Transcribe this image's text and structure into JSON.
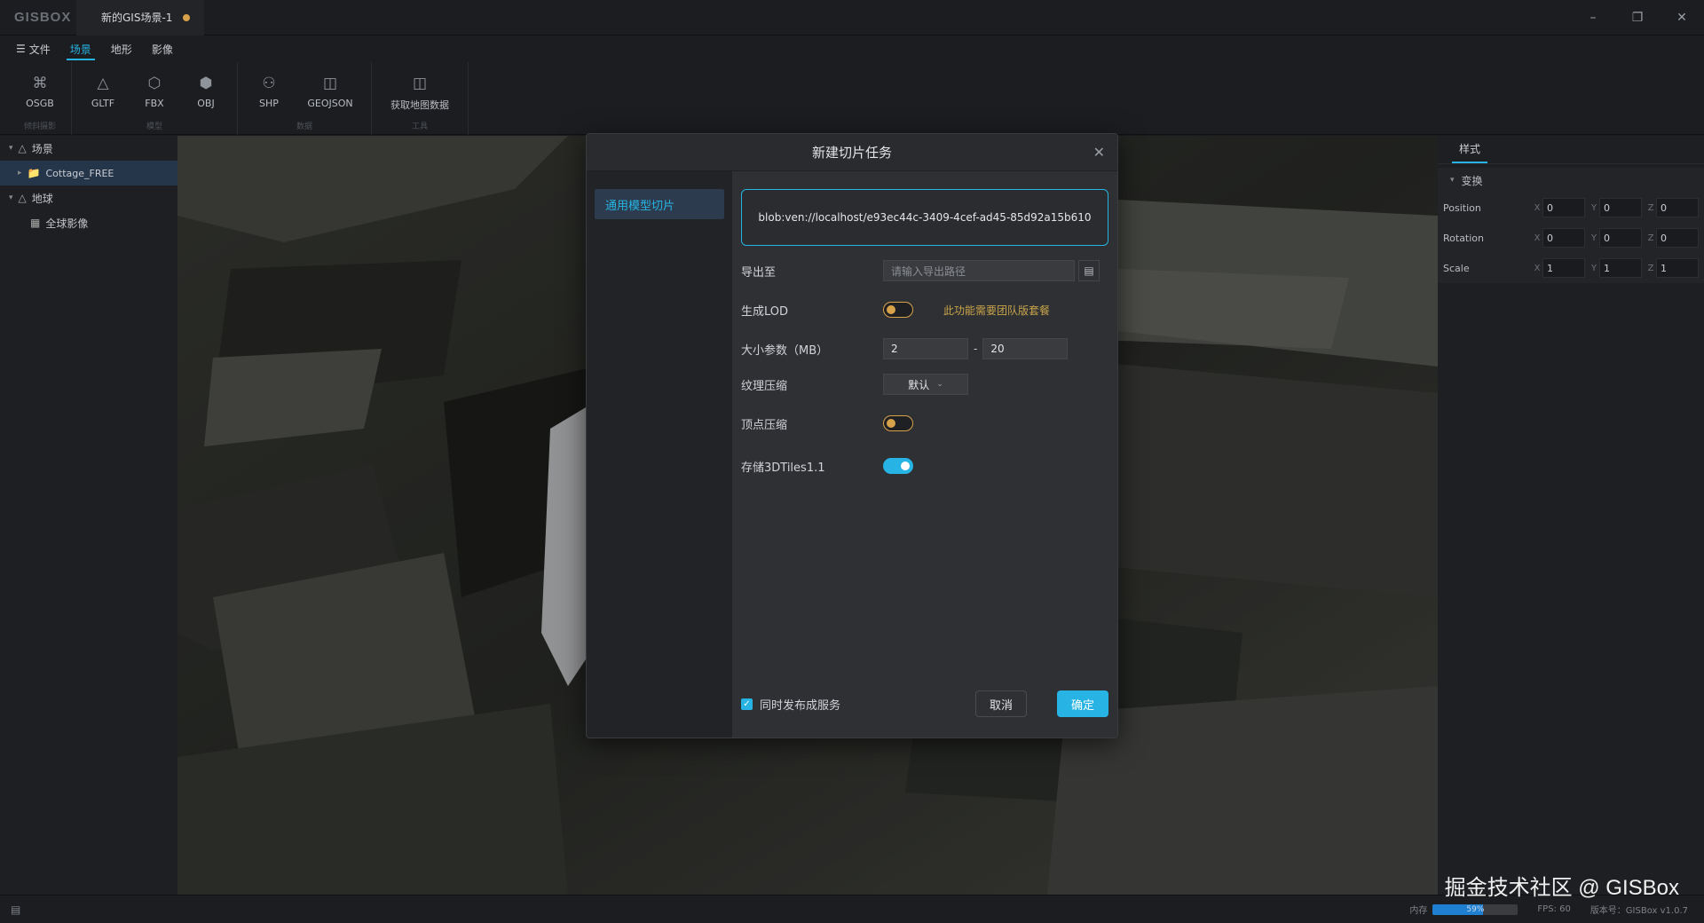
{
  "app": {
    "logo": "GISBOX",
    "doc_tab": "新的GIS场景-1",
    "unsaved_color": "#d8a24a",
    "window_controls": [
      "minimize-icon",
      "restore-icon",
      "close-icon"
    ]
  },
  "menu": {
    "file": "文件",
    "tabs": [
      "场景",
      "地形",
      "影像"
    ],
    "active_tab": "场景"
  },
  "toolbar": {
    "groups": [
      {
        "caption": "倾斜摄影",
        "tools": [
          {
            "label": "OSGB",
            "icon": "osgb-icon"
          }
        ]
      },
      {
        "caption": "模型",
        "tools": [
          {
            "label": "GLTF",
            "icon": "gltf-icon"
          },
          {
            "label": "FBX",
            "icon": "fbx-icon"
          },
          {
            "label": "OBJ",
            "icon": "obj-icon"
          }
        ]
      },
      {
        "caption": "数据",
        "tools": [
          {
            "label": "SHP",
            "icon": "shp-icon"
          },
          {
            "label": "GEOJSON",
            "icon": "geojson-icon"
          }
        ]
      },
      {
        "caption": "工具",
        "tools": [
          {
            "label": "获取地图数据",
            "icon": "map-data-icon"
          }
        ]
      }
    ]
  },
  "scene_tree": {
    "scene": "场景",
    "scene_child": "Cottage_FREE",
    "globe": "地球",
    "globe_child": "全球影像"
  },
  "right_panel": {
    "tab": "样式",
    "section": "变换",
    "props": [
      {
        "label": "Position",
        "x": "0",
        "y": "0",
        "z": "0"
      },
      {
        "label": "Rotation",
        "x": "0",
        "y": "0",
        "z": "0"
      },
      {
        "label": "Scale",
        "x": "1",
        "y": "1",
        "z": "1"
      }
    ]
  },
  "dialog": {
    "title": "新建切片任务",
    "side_item": "通用模型切片",
    "file_url": "blob:ven://localhost/e93ec44c-3409-4cef-ad45-85d92a15b610",
    "export_label": "导出至",
    "export_placeholder": "请输入导出路径",
    "lod_label": "生成LOD",
    "lod_hint": "此功能需要团队版套餐",
    "lod_on": false,
    "size_label": "大小参数（MB）",
    "size_min": "2",
    "size_max": "20",
    "texture_label": "纹理压缩",
    "texture_value": "默认",
    "vertex_label": "顶点压缩",
    "vertex_on": false,
    "tiles_label": "存储3DTiles1.1",
    "tiles_on": true,
    "publish_label": "同时发布成服务",
    "publish_checked": true,
    "cancel": "取消",
    "ok": "确定"
  },
  "status": {
    "memory_label": "内存",
    "memory_percent": "59%",
    "memory_fraction": 0.59,
    "fps": "FPS: 60",
    "version": "版本号：GISBox v1.0.7"
  },
  "watermark": "掘金技术社区 @ GISBox",
  "colors": {
    "accent": "#27b4e4",
    "warn": "#d8a24a",
    "bg": "#1a1b1e",
    "panel": "#1e1f22"
  }
}
